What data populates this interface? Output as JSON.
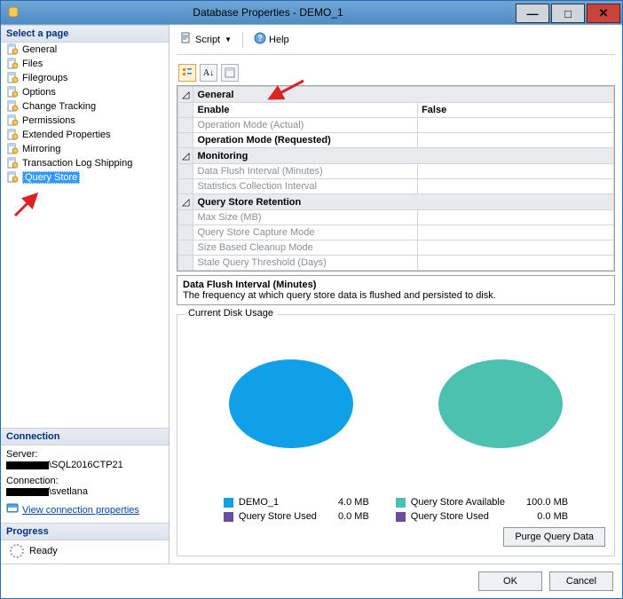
{
  "window": {
    "title": "Database Properties - DEMO_1"
  },
  "left": {
    "select_page": "Select a page",
    "pages": [
      "General",
      "Files",
      "Filegroups",
      "Options",
      "Change Tracking",
      "Permissions",
      "Extended Properties",
      "Mirroring",
      "Transaction Log Shipping",
      "Query Store"
    ],
    "selected_index": 9,
    "connection_header": "Connection",
    "server_label": "Server:",
    "server_value_suffix": "\\SQL2016CTP21",
    "connection_label": "Connection:",
    "connection_value_suffix": "\\svetlana",
    "view_conn": "View connection properties",
    "progress_header": "Progress",
    "progress_status": "Ready"
  },
  "toolbar": {
    "script": "Script",
    "help": "Help"
  },
  "grid": {
    "cat_general": "General",
    "enable": "Enable",
    "enable_val": "False",
    "op_actual": "Operation Mode (Actual)",
    "op_requested": "Operation Mode (Requested)",
    "cat_monitoring": "Monitoring",
    "flush": "Data Flush Interval (Minutes)",
    "stats": "Statistics Collection Interval",
    "cat_retention": "Query Store Retention",
    "max_size": "Max Size (MB)",
    "capture_mode": "Query Store Capture Mode",
    "cleanup_mode": "Size Based Cleanup Mode",
    "stale": "Stale Query Threshold (Days)"
  },
  "desc": {
    "title": "Data Flush Interval (Minutes)",
    "text": "The frequency at which query store data is flushed and persisted to disk."
  },
  "disk": {
    "title": "Current Disk Usage",
    "legend": [
      {
        "swatch": "#0fa0e8",
        "label": "DEMO_1",
        "value": "4.0 MB"
      },
      {
        "swatch": "#6a4ca0",
        "label": "Query Store Used",
        "value": "0.0 MB"
      },
      {
        "swatch": "#4cc1b0",
        "label": "Query Store Available",
        "value": "100.0 MB"
      },
      {
        "swatch": "#6a4ca0",
        "label": "Query Store Used",
        "value": "0.0 MB"
      }
    ],
    "purge": "Purge Query Data"
  },
  "footer": {
    "ok": "OK",
    "cancel": "Cancel"
  },
  "chart_data": [
    {
      "type": "pie",
      "title": "DEMO_1 disk usage",
      "series": [
        {
          "name": "DEMO_1",
          "value_mb": 4.0,
          "color": "#0fa0e8"
        },
        {
          "name": "Query Store Used",
          "value_mb": 0.0,
          "color": "#6a4ca0"
        }
      ]
    },
    {
      "type": "pie",
      "title": "Query Store disk usage",
      "series": [
        {
          "name": "Query Store Available",
          "value_mb": 100.0,
          "color": "#4cc1b0"
        },
        {
          "name": "Query Store Used",
          "value_mb": 0.0,
          "color": "#6a4ca0"
        }
      ]
    }
  ]
}
